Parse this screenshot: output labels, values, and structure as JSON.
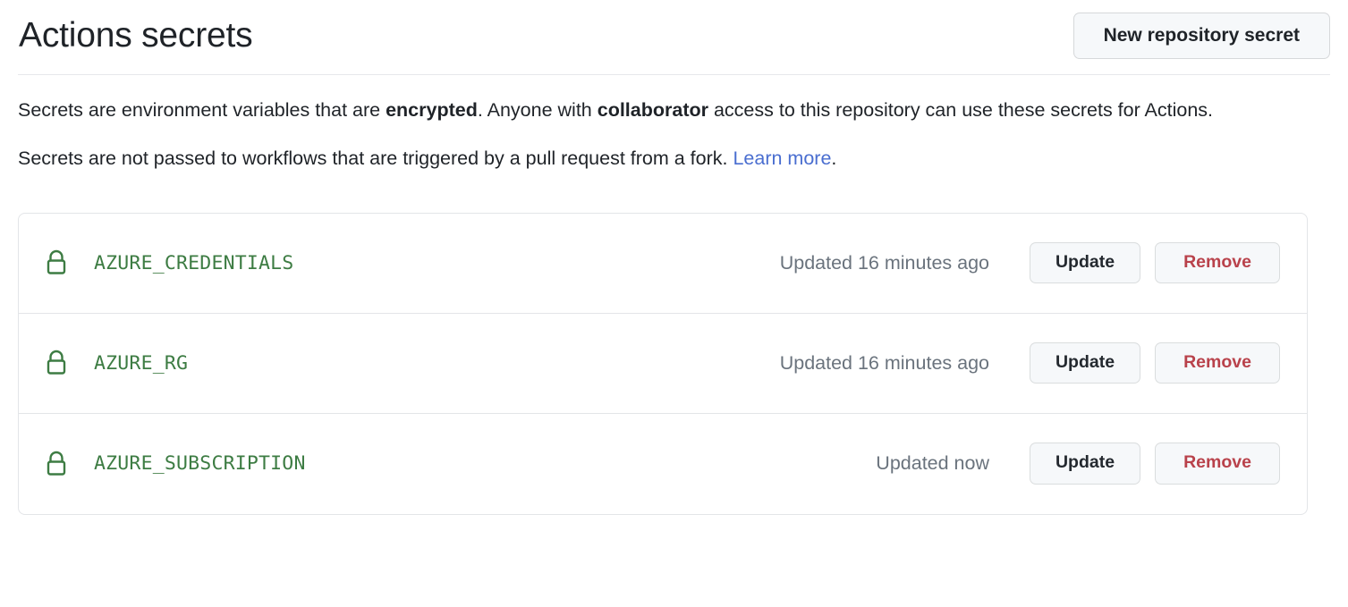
{
  "header": {
    "title": "Actions secrets",
    "new_secret_button": "New repository secret"
  },
  "description": {
    "p1_part1": "Secrets are environment variables that are ",
    "p1_bold1": "encrypted",
    "p1_part2": ". Anyone with ",
    "p1_bold2": "collaborator",
    "p1_part3": " access to this repository can use these secrets for Actions.",
    "p2_part1": "Secrets are not passed to workflows that are triggered by a pull request from a fork. ",
    "p2_link": "Learn more",
    "p2_part2": "."
  },
  "colors": {
    "secret_name_green": "#3d7c43",
    "remove_red": "#b9424b",
    "link_blue": "#4a6ed0",
    "muted_gray": "#6a737d",
    "button_bg": "#f6f8fa",
    "border": "#e3e5e8"
  },
  "secrets": [
    {
      "icon": "lock-icon",
      "name": "AZURE_CREDENTIALS",
      "updated": "Updated 16 minutes ago",
      "update_label": "Update",
      "remove_label": "Remove"
    },
    {
      "icon": "lock-icon",
      "name": "AZURE_RG",
      "updated": "Updated 16 minutes ago",
      "update_label": "Update",
      "remove_label": "Remove"
    },
    {
      "icon": "lock-icon",
      "name": "AZURE_SUBSCRIPTION",
      "updated": "Updated now",
      "update_label": "Update",
      "remove_label": "Remove"
    }
  ]
}
